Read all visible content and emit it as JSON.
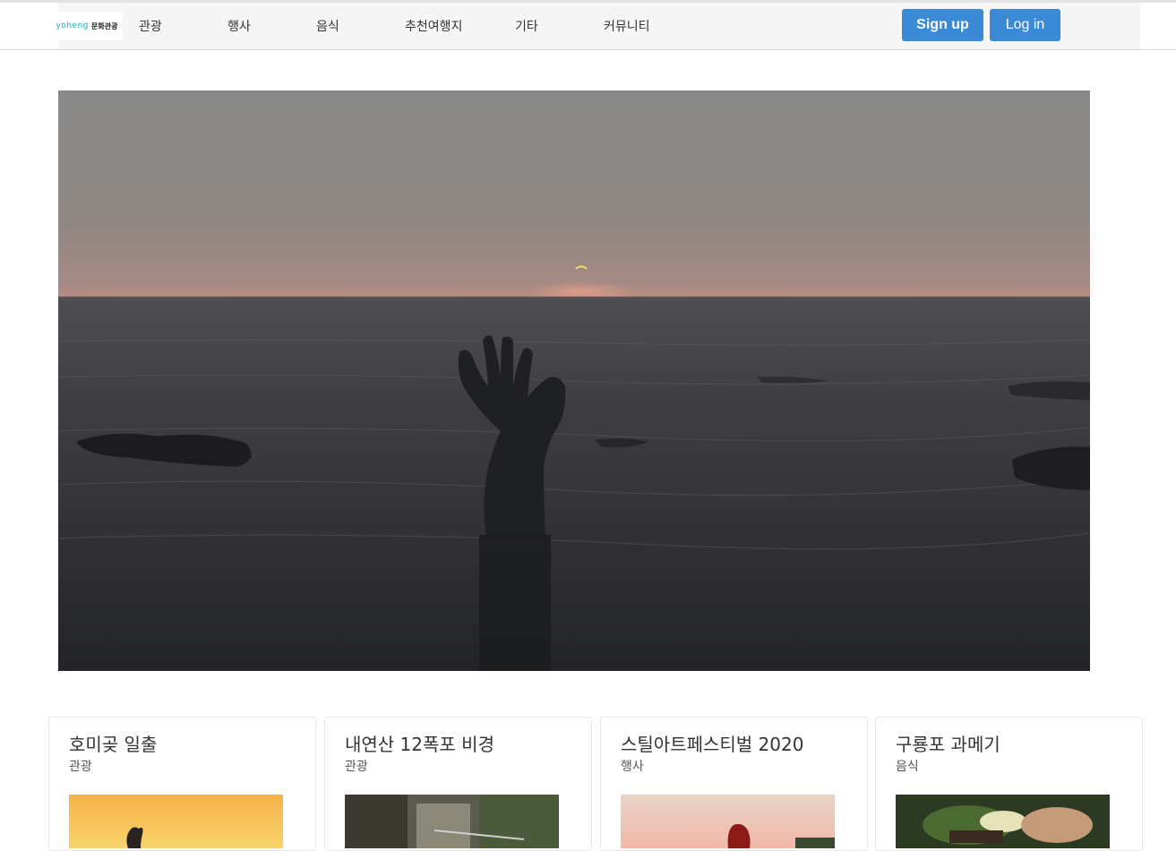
{
  "header": {
    "logo": {
      "mark": "yoheng",
      "text": "문화관광"
    },
    "nav": [
      "관광",
      "행사",
      "음식",
      "추천여행지",
      "기타",
      "커뮤니티"
    ],
    "signup_label": "Sign up",
    "login_label": "Log in"
  },
  "hero": {
    "image": "sea-hand-sculpture-sunrise"
  },
  "cards": [
    {
      "title": "호미곶 일출",
      "category": "관광",
      "image": "sunrise-hand-sculpture"
    },
    {
      "title": "내연산 12폭포 비경",
      "category": "관광",
      "image": "waterfall-cliff"
    },
    {
      "title": "스틸아트페스티벌 2020",
      "category": "행사",
      "image": "steel-art-sculpture"
    },
    {
      "title": "구룡포 과메기",
      "category": "음식",
      "image": "gwamegi-dish"
    }
  ],
  "colors": {
    "accent": "#3a8ad6",
    "header_bg": "#f5f5f5"
  }
}
